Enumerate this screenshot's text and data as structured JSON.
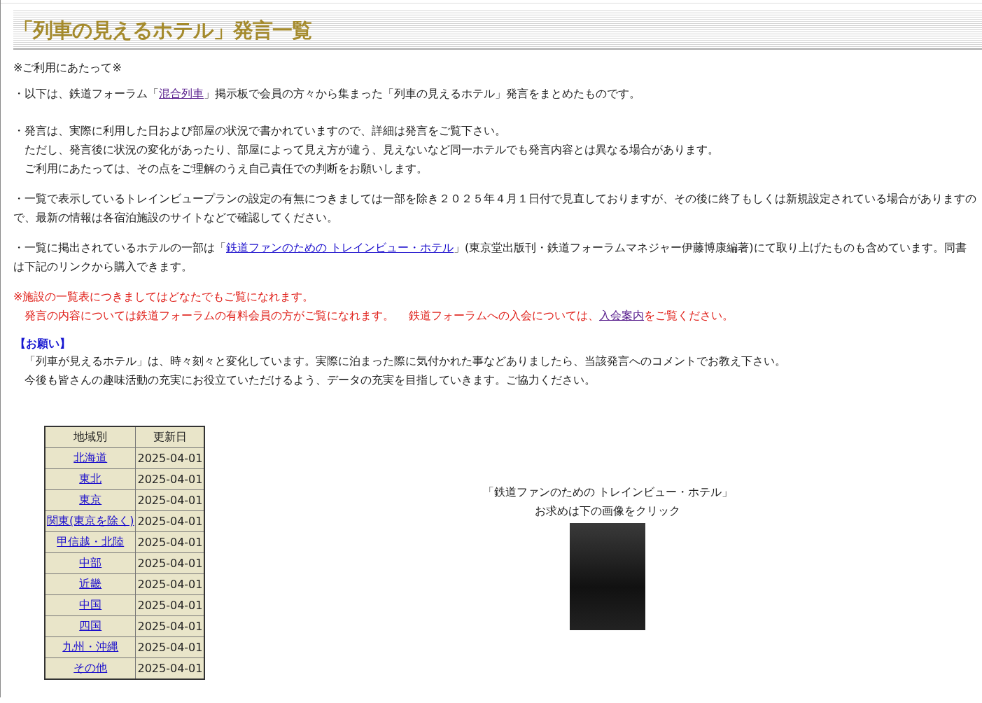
{
  "title": "「列車の見えるホテル」発言一覧",
  "notice_heading": "※ご利用にあたって※",
  "paragraphs": [
    {
      "kind": "normal",
      "lines": [
        [
          {
            "kind": "text",
            "text": "・以下は、鉄道フォーラム「"
          },
          {
            "kind": "link",
            "text": "混合列車",
            "visited": true
          },
          {
            "kind": "text",
            "text": "」掲示板で会員の方々から集まった「列車の見えるホテル」発言をまとめたものです。"
          }
        ]
      ]
    },
    {
      "kind": "normal",
      "lines": [
        [
          {
            "kind": "text",
            "text": "・発言は、実際に利用した日および部屋の状況で書かれていますので、詳細は発言をご覧下さい。"
          }
        ],
        [
          {
            "kind": "text",
            "text": "　ただし、発言後に状況の変化があったり、部屋によって見え方が違う、見えないなど同一ホテルでも発言内容とは異なる場合があります。"
          }
        ],
        [
          {
            "kind": "text",
            "text": "　ご利用にあたっては、その点をご理解のうえ自己責任での判断をお願いします。"
          }
        ]
      ]
    },
    {
      "kind": "normal",
      "lines": [
        [
          {
            "kind": "text",
            "text": "・一覧で表示しているトレインビュープランの設定の有無につきましては一部を除き２０２５年４月１日付で見直しておりますが、その後に終了もしくは新規設定されている場合がありますので、最新の情報は各宿泊施設のサイトなどで確認してください。"
          }
        ]
      ]
    },
    {
      "kind": "normal",
      "lines": [
        [
          {
            "kind": "text",
            "text": "・一覧に掲出されているホテルの一部は「"
          },
          {
            "kind": "link",
            "text": "鉄道ファンのための トレインビュー・ホテル",
            "visited": false
          },
          {
            "kind": "text",
            "text": "」(東京堂出版刊・鉄道フォーラムマネジャー伊藤博康編著)にて取り上げたものも含めています。同書は下記のリンクから購入できます。"
          }
        ]
      ]
    },
    {
      "kind": "alert",
      "lines": [
        [
          {
            "kind": "text",
            "text": "※施設の一覧表につきましてはどなたでもご覧になれます。"
          }
        ],
        [
          {
            "kind": "text",
            "text": "　発言の内容については鉄道フォーラムの有料会員の方がご覧になれます。　 鉄道フォーラムへの入会については、"
          },
          {
            "kind": "link",
            "text": "入会案内",
            "visited": true
          },
          {
            "kind": "text",
            "text": "をご覧ください。"
          }
        ]
      ]
    },
    {
      "kind": "request",
      "heading": "【お願い】",
      "lines": [
        [
          {
            "kind": "text",
            "text": "　「列車が見えるホテル」は、時々刻々と変化しています。実際に泊まった際に気付かれた事などありましたら、当該発言へのコメントでお教え下さい。"
          }
        ],
        [
          {
            "kind": "text",
            "text": "　今後も皆さんの趣味活動の充実にお役立ていただけるよう、データの充実を目指していきます。ご協力ください。"
          }
        ]
      ]
    }
  ],
  "table": {
    "columns": [
      "地域別",
      "更新日"
    ],
    "rows": [
      {
        "region": "北海道",
        "updated": "2025-04-01"
      },
      {
        "region": "東北",
        "updated": "2025-04-01"
      },
      {
        "region": "東京",
        "updated": "2025-04-01"
      },
      {
        "region": "関東(東京を除く)",
        "updated": "2025-04-01"
      },
      {
        "region": "甲信越・北陸",
        "updated": "2025-04-01"
      },
      {
        "region": "中部",
        "updated": "2025-04-01"
      },
      {
        "region": "近畿",
        "updated": "2025-04-01"
      },
      {
        "region": "中国",
        "updated": "2025-04-01"
      },
      {
        "region": "四国",
        "updated": "2025-04-01"
      },
      {
        "region": "九州・沖縄",
        "updated": "2025-04-01"
      },
      {
        "region": "その他",
        "updated": "2025-04-01"
      }
    ]
  },
  "book": {
    "caption_lines": [
      "「鉄道ファンのための トレインビュー・ホテル」",
      "お求めは下の画像をクリック"
    ]
  }
}
